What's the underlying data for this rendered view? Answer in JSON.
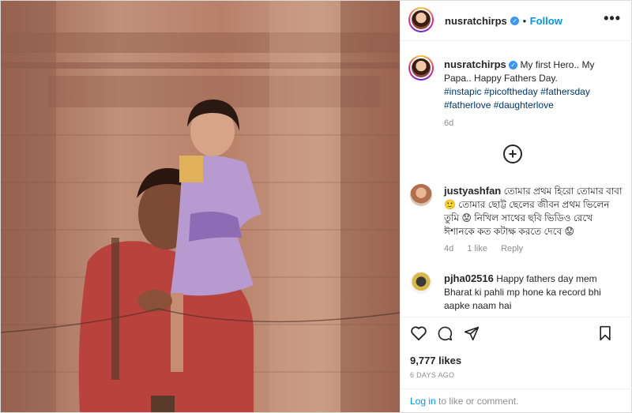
{
  "post": {
    "username": "nusratchirps",
    "follow_label": "Follow",
    "separator": "•",
    "more_label": "•••"
  },
  "caption": {
    "username": "nusratchirps",
    "text": "My first Hero.. My Papa.. Happy Fathers Day.",
    "hashtags": [
      "#instapic",
      "#picoftheday",
      "#fathersday",
      "#fatherlove",
      "#daughterlove"
    ],
    "age": "6d"
  },
  "comments": [
    {
      "username": "justyashfan",
      "text": "তোমার প্রথম হিরো তোমার বাবা 🙂 তোমার ছোট্ট ছেলের জীবন প্রথম ভিলেন তুমি 😟 নিখিল সাথের ছবি ভিডিও রেখে ঈশানকে কত কটাক্ষ করতে দেবে 😟",
      "age": "4d",
      "likes": "1 like",
      "reply": "Reply"
    },
    {
      "username": "pjha02516",
      "text": "Happy fathers day mem Bharat ki pahli mp hone ka record bhi aapke naam hai"
    }
  ],
  "likes": "9,777 likes",
  "date": "6 DAYS AGO",
  "login": {
    "link": "Log in",
    "rest": "to like or comment."
  },
  "icons": {
    "heart": "heart-icon",
    "comment": "comment-icon",
    "share": "share-icon",
    "save": "bookmark-icon",
    "add": "plus-circle-icon",
    "verified": "verified-badge-icon"
  },
  "colors": {
    "link_blue": "#0095f6",
    "hashtag": "#00376b",
    "muted": "#8e8e8e",
    "verified": "#3897f0"
  }
}
